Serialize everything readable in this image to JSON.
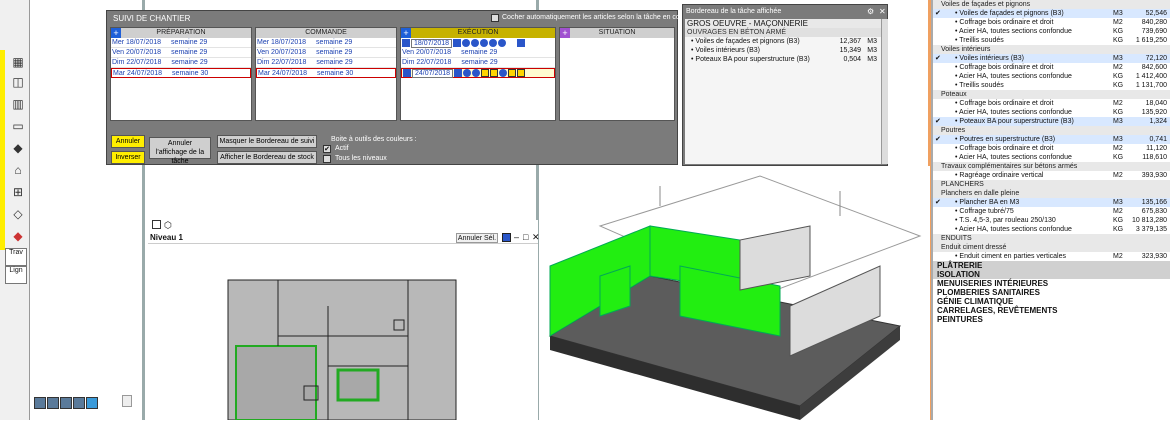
{
  "left_toolbar": {
    "labels": [
      "Trav",
      "Lign"
    ]
  },
  "suivi": {
    "title": "SUIVI DE CHANTIER",
    "auto_check_label": "Cocher automatiquement les articles selon la tâche en cours",
    "columns": {
      "preparation": "PRÉPARATION",
      "commande": "COMMANDE",
      "execution": "EXÉCUTION",
      "situation": "SITUATION"
    },
    "prep_rows": [
      {
        "date": "Mer 18/07/2018",
        "week": "semaine 29"
      },
      {
        "date": "Ven 20/07/2018",
        "week": "semaine 29"
      },
      {
        "date": "Dim 22/07/2018",
        "week": "semaine 29"
      },
      {
        "date": "Mar 24/07/2018",
        "week": "semaine 30"
      }
    ],
    "cmd_rows": [
      {
        "date": "Mer 18/07/2018",
        "week": "semaine 29"
      },
      {
        "date": "Ven 20/07/2018",
        "week": "semaine 29"
      },
      {
        "date": "Dim 22/07/2018",
        "week": "semaine 29"
      },
      {
        "date": "Mar 24/07/2018",
        "week": "semaine 30"
      }
    ],
    "exe_rows": [
      {
        "date": "18/07/2018",
        "week": ""
      },
      {
        "date": "Ven 20/07/2018",
        "week": "semaine 29"
      },
      {
        "date": "Dim 22/07/2018",
        "week": "semaine 29"
      },
      {
        "date": "24/07/2018",
        "week": ""
      }
    ],
    "buttons": {
      "annuler": "Annuler",
      "inverser": "Inverser",
      "annuler_affichage": "Annuler l'affichage de la tâche",
      "masquer_bordereau": "Masquer le Bordereau de suivi",
      "afficher_stock": "Afficher le Bordereau de stock"
    },
    "boite_label": "Boite à outils des couleurs :",
    "actif_label": "Actif",
    "tous_niveaux_label": "Tous les niveaux"
  },
  "bordereau": {
    "title": "Bordereau de la tâche affichée",
    "section": "GROS OEUVRE - MAÇONNERIE",
    "subsection": "OUVRAGES EN BÉTON ARMÉ",
    "items": [
      {
        "label": "• Voiles de façades et pignons (B3)",
        "qty": "12,367",
        "unit": "M3"
      },
      {
        "label": "• Voiles intérieurs (B3)",
        "qty": "15,349",
        "unit": "M3"
      },
      {
        "label": "• Poteaux BA pour superstructure (B3)",
        "qty": "0,504",
        "unit": "M3"
      }
    ]
  },
  "plan": {
    "title": "Niveau 1",
    "annuler_sel": "Annuler Sél."
  },
  "boq": {
    "rows": [
      {
        "kind": "sec",
        "label": "Voiles de façades et pignons",
        "unit": "",
        "qty": "",
        "check": ""
      },
      {
        "kind": "item",
        "label": "• Voiles de façades et pignons (B3)",
        "unit": "M3",
        "qty": "52,546",
        "check": "✔"
      },
      {
        "kind": "item",
        "label": "• Coffrage bois ordinaire et droit",
        "unit": "M2",
        "qty": "840,280",
        "check": ""
      },
      {
        "kind": "item",
        "label": "• Acier HA, toutes sections confondue",
        "unit": "KG",
        "qty": "739,690",
        "check": ""
      },
      {
        "kind": "item",
        "label": "• Treillis soudés",
        "unit": "KG",
        "qty": "1 619,250",
        "check": ""
      },
      {
        "kind": "sec",
        "label": "Voiles intérieurs",
        "unit": "",
        "qty": "",
        "check": ""
      },
      {
        "kind": "item",
        "label": "• Voiles intérieurs (B3)",
        "unit": "M3",
        "qty": "72,120",
        "check": "✔"
      },
      {
        "kind": "item",
        "label": "• Coffrage bois ordinaire et droit",
        "unit": "M2",
        "qty": "842,600",
        "check": ""
      },
      {
        "kind": "item",
        "label": "• Acier HA, toutes sections confondue",
        "unit": "KG",
        "qty": "1 412,400",
        "check": ""
      },
      {
        "kind": "item",
        "label": "• Treillis soudés",
        "unit": "KG",
        "qty": "1 131,700",
        "check": ""
      },
      {
        "kind": "sec",
        "label": "Poteaux",
        "unit": "",
        "qty": "",
        "check": ""
      },
      {
        "kind": "item",
        "label": "• Coffrage bois ordinaire et droit",
        "unit": "M2",
        "qty": "18,040",
        "check": ""
      },
      {
        "kind": "item",
        "label": "• Acier HA, toutes sections confondue",
        "unit": "KG",
        "qty": "135,920",
        "check": ""
      },
      {
        "kind": "item",
        "label": "• Poteaux BA pour superstructure (B3)",
        "unit": "M3",
        "qty": "1,324",
        "check": "✔"
      },
      {
        "kind": "sec",
        "label": "Poutres",
        "unit": "",
        "qty": "",
        "check": ""
      },
      {
        "kind": "item",
        "label": "• Poutres en superstructure (B3)",
        "unit": "M3",
        "qty": "0,741",
        "check": "✔"
      },
      {
        "kind": "item",
        "label": "• Coffrage bois ordinaire et droit",
        "unit": "M2",
        "qty": "11,120",
        "check": ""
      },
      {
        "kind": "item",
        "label": "• Acier HA, toutes sections confondue",
        "unit": "KG",
        "qty": "118,610",
        "check": ""
      },
      {
        "kind": "sec",
        "label": "Travaux complémentaires sur bétons armés",
        "unit": "",
        "qty": "",
        "check": ""
      },
      {
        "kind": "item",
        "label": "• Ragréage ordinaire vertical",
        "unit": "M2",
        "qty": "393,930",
        "check": ""
      },
      {
        "kind": "sec",
        "label": "PLANCHERS",
        "unit": "",
        "qty": "",
        "check": ""
      },
      {
        "kind": "sec",
        "label": "Planchers en dalle pleine",
        "unit": "",
        "qty": "",
        "check": ""
      },
      {
        "kind": "item",
        "label": "• Plancher BA en M3",
        "unit": "M3",
        "qty": "135,166",
        "check": "✔"
      },
      {
        "kind": "item",
        "label": "• Coffrage tubré/75",
        "unit": "M2",
        "qty": "675,830",
        "check": ""
      },
      {
        "kind": "item",
        "label": "• T.S. 4,5-3, par rouleau 250/130",
        "unit": "KG",
        "qty": "10 813,280",
        "check": ""
      },
      {
        "kind": "item",
        "label": "• Acier HA, toutes sections confondue",
        "unit": "KG",
        "qty": "3 379,135",
        "check": ""
      },
      {
        "kind": "sec",
        "label": "ENDUITS",
        "unit": "",
        "qty": "",
        "check": ""
      },
      {
        "kind": "sec",
        "label": "Enduit ciment dressé",
        "unit": "",
        "qty": "",
        "check": ""
      },
      {
        "kind": "item",
        "label": "• Enduit ciment en parties verticales",
        "unit": "M2",
        "qty": "323,930",
        "check": ""
      },
      {
        "kind": "major",
        "label": "PLÂTRERIE",
        "unit": "",
        "qty": "",
        "check": ""
      },
      {
        "kind": "major",
        "label": "ISOLATION",
        "unit": "",
        "qty": "",
        "check": ""
      },
      {
        "kind": "major2",
        "label": "MENUISERIES INTÉRIEURES",
        "unit": "",
        "qty": "",
        "check": ""
      },
      {
        "kind": "major2",
        "label": "PLOMBERIES SANITAIRES",
        "unit": "",
        "qty": "",
        "check": ""
      },
      {
        "kind": "major2",
        "label": "GÉNIE CLIMATIQUE",
        "unit": "",
        "qty": "",
        "check": ""
      },
      {
        "kind": "major2",
        "label": "CARRELAGES, REVÊTEMENTS",
        "unit": "",
        "qty": "",
        "check": ""
      },
      {
        "kind": "major2",
        "label": "PEINTURES",
        "unit": "",
        "qty": "",
        "check": ""
      }
    ]
  },
  "colors": {
    "panel_grey": "#7b7b7b",
    "accent_blue": "#1e5fd8",
    "accent_yellow": "#ffee00",
    "exec_header": "#c6b200",
    "highlight_green": "#22ee11"
  }
}
